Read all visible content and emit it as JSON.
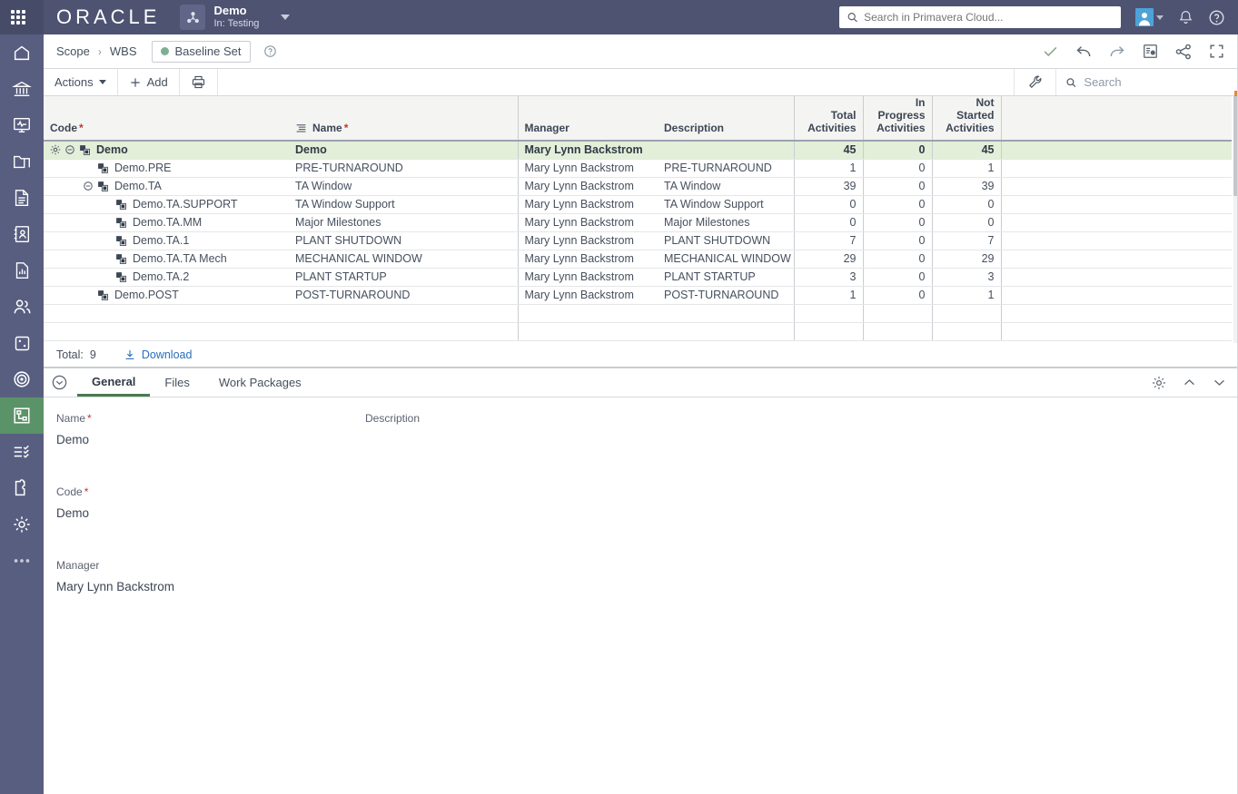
{
  "header": {
    "waffle_icon": "grid-apps-icon",
    "brand": "ORACLE",
    "project_name": "Demo",
    "project_context": "In: Testing",
    "project_icon": "project-network-icon",
    "search_placeholder": "Search in Primavera Cloud...",
    "search_value": "",
    "search_icon": "search-icon",
    "avatar_icon": "user-avatar-icon",
    "notifications_icon": "bell-icon",
    "help_icon": "help-circle-icon"
  },
  "sidebar": {
    "items": [
      {
        "name": "home",
        "icon": "home-icon",
        "active": false
      },
      {
        "name": "portfolio",
        "icon": "bank-icon",
        "active": false
      },
      {
        "name": "dashboards",
        "icon": "monitor-pulse-icon",
        "active": false
      },
      {
        "name": "files",
        "icon": "folder-icon",
        "active": false
      },
      {
        "name": "documents",
        "icon": "document-icon",
        "active": false
      },
      {
        "name": "directory",
        "icon": "contact-card-icon",
        "active": false
      },
      {
        "name": "reports",
        "icon": "report-chart-icon",
        "active": false
      },
      {
        "name": "resources",
        "icon": "people-icon",
        "active": false
      },
      {
        "name": "risk",
        "icon": "dice-icon",
        "active": false
      },
      {
        "name": "scope-targets",
        "icon": "target-icon",
        "active": false
      },
      {
        "name": "wbs",
        "icon": "hierarchy-icon",
        "active": true
      },
      {
        "name": "tasks",
        "icon": "checklist-icon",
        "active": false
      },
      {
        "name": "integrations",
        "icon": "puzzle-icon",
        "active": false
      },
      {
        "name": "settings",
        "icon": "gear-icon",
        "active": false
      },
      {
        "name": "more",
        "icon": "ellipsis-icon",
        "active": false
      }
    ]
  },
  "breadcrumb": {
    "items": [
      "Scope",
      "WBS"
    ],
    "separator": "›",
    "baseline_chip": "Baseline Set",
    "baseline_dot_color": "#7eaf95",
    "help_icon": "help-circle-icon",
    "actions": [
      {
        "name": "check-icon",
        "label": "Check"
      },
      {
        "name": "undo-icon",
        "label": "Undo"
      },
      {
        "name": "redo-icon",
        "label": "Redo"
      },
      {
        "name": "report-icon",
        "label": "Report"
      },
      {
        "name": "share-icon",
        "label": "Share"
      },
      {
        "name": "fullscreen-icon",
        "label": "Full Screen"
      }
    ]
  },
  "toolbar": {
    "actions_label": "Actions",
    "add_label": "Add",
    "add_icon": "plus-icon",
    "print_icon": "printer-icon",
    "wrench_icon": "wrench-icon",
    "search_icon": "search-icon",
    "search_placeholder": "Search",
    "search_value": ""
  },
  "grid": {
    "columns": [
      {
        "key": "code",
        "label": "Code",
        "required": true,
        "align": "left"
      },
      {
        "key": "name",
        "label": "Name",
        "required": true,
        "align": "left",
        "icon": "indent-lines-icon"
      },
      {
        "key": "manager",
        "label": "Manager",
        "required": false,
        "align": "left"
      },
      {
        "key": "description",
        "label": "Description",
        "required": false,
        "align": "left"
      },
      {
        "key": "total",
        "label": "Total Activities",
        "required": false,
        "align": "right"
      },
      {
        "key": "in_progress",
        "label": "In Progress Activities",
        "required": false,
        "align": "right"
      },
      {
        "key": "not_started",
        "label": "Not Started Activities",
        "required": false,
        "align": "right"
      }
    ],
    "rows": [
      {
        "code": "Demo",
        "name": "Demo",
        "manager": "Mary Lynn Backstrom",
        "description": "",
        "total": "45",
        "in_progress": "0",
        "not_started": "45",
        "level": 0,
        "selected": true,
        "expander": "collapse",
        "gear": true
      },
      {
        "code": "Demo.PRE",
        "name": "PRE-TURNAROUND",
        "manager": "Mary Lynn Backstrom",
        "description": "PRE-TURNAROUND",
        "total": "1",
        "in_progress": "0",
        "not_started": "1",
        "level": 1,
        "selected": false,
        "expander": "none",
        "gear": false
      },
      {
        "code": "Demo.TA",
        "name": "TA Window",
        "manager": "Mary Lynn Backstrom",
        "description": "TA Window",
        "total": "39",
        "in_progress": "0",
        "not_started": "39",
        "level": 1,
        "selected": false,
        "expander": "collapse",
        "gear": false
      },
      {
        "code": "Demo.TA.SUPPORT",
        "name": "TA Window Support",
        "manager": "Mary Lynn Backstrom",
        "description": "TA Window Support",
        "total": "0",
        "in_progress": "0",
        "not_started": "0",
        "level": 2,
        "selected": false,
        "expander": "none",
        "gear": false
      },
      {
        "code": "Demo.TA.MM",
        "name": "Major Milestones",
        "manager": "Mary Lynn Backstrom",
        "description": "Major Milestones",
        "total": "0",
        "in_progress": "0",
        "not_started": "0",
        "level": 2,
        "selected": false,
        "expander": "none",
        "gear": false
      },
      {
        "code": "Demo.TA.1",
        "name": "PLANT SHUTDOWN",
        "manager": "Mary Lynn Backstrom",
        "description": "PLANT SHUTDOWN",
        "total": "7",
        "in_progress": "0",
        "not_started": "7",
        "level": 2,
        "selected": false,
        "expander": "none",
        "gear": false
      },
      {
        "code": "Demo.TA.TA Mech",
        "name": "MECHANICAL WINDOW",
        "manager": "Mary Lynn Backstrom",
        "description": "MECHANICAL WINDOW",
        "total": "29",
        "in_progress": "0",
        "not_started": "29",
        "level": 2,
        "selected": false,
        "expander": "none",
        "gear": false
      },
      {
        "code": "Demo.TA.2",
        "name": "PLANT STARTUP",
        "manager": "Mary Lynn Backstrom",
        "description": "PLANT STARTUP",
        "total": "3",
        "in_progress": "0",
        "not_started": "3",
        "level": 2,
        "selected": false,
        "expander": "none",
        "gear": false
      },
      {
        "code": "Demo.POST",
        "name": "POST-TURNAROUND",
        "manager": "Mary Lynn Backstrom",
        "description": "POST-TURNAROUND",
        "total": "1",
        "in_progress": "0",
        "not_started": "1",
        "level": 1,
        "selected": false,
        "expander": "none",
        "gear": false
      }
    ],
    "footer": {
      "total_label": "Total:",
      "total_value": "9",
      "download_label": "Download",
      "download_icon": "download-icon"
    }
  },
  "detail": {
    "collapse_icon": "chevron-circle-down-icon",
    "tabs": [
      {
        "label": "General",
        "active": true
      },
      {
        "label": "Files",
        "active": false
      },
      {
        "label": "Work Packages",
        "active": false
      }
    ],
    "settings_icon": "gear-icon",
    "up_icon": "chevron-up-icon",
    "down_icon": "chevron-down-icon",
    "general": {
      "name_label": "Name",
      "name_required": true,
      "name_value": "Demo",
      "code_label": "Code",
      "code_required": true,
      "code_value": "Demo",
      "manager_label": "Manager",
      "manager_value": "Mary Lynn Backstrom",
      "description_label": "Description",
      "description_value": ""
    }
  },
  "colors": {
    "header_bg": "#4e5372",
    "sidebar_bg": "#585e80",
    "sidebar_active": "#5a9367",
    "row_selected": "#e3efd9",
    "link": "#2a6ebb",
    "required": "#c0392b",
    "tab_underline": "#4a7a4f"
  }
}
